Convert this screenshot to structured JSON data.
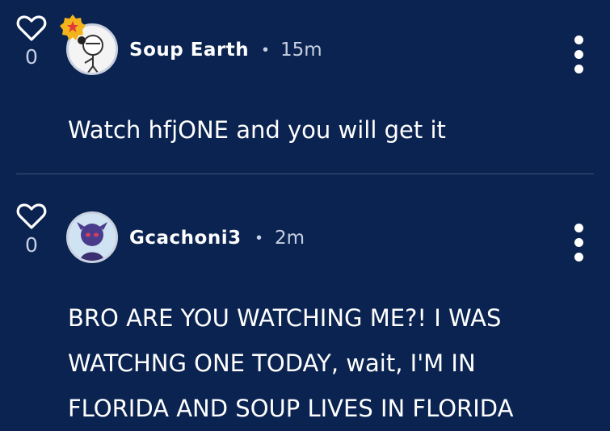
{
  "comments": [
    {
      "likes": "0",
      "author": "Soup Earth",
      "separator": "•",
      "time": "15m",
      "text": "Watch hfjONE and you will get it",
      "has_badge": true
    },
    {
      "likes": "0",
      "author": "Gcachoni3",
      "separator": "•",
      "time": "2m",
      "text_lines": [
        "BRO ARE YOU WATCHING ME?! I WAS",
        "WATCHNG ONE TODAY, wait, I'M IN",
        "FLORIDA AND SOUP LIVES IN FLORIDA"
      ]
    }
  ],
  "colors": {
    "background": "#0b2350",
    "text": "#ffffff",
    "muted": "#c7d0e2",
    "badge": "#f3b41b",
    "badge_star": "#e23a3a"
  },
  "icons": {
    "like": "heart-outline-icon",
    "more": "vertical-ellipsis-icon",
    "badge": "star-badge-icon"
  }
}
